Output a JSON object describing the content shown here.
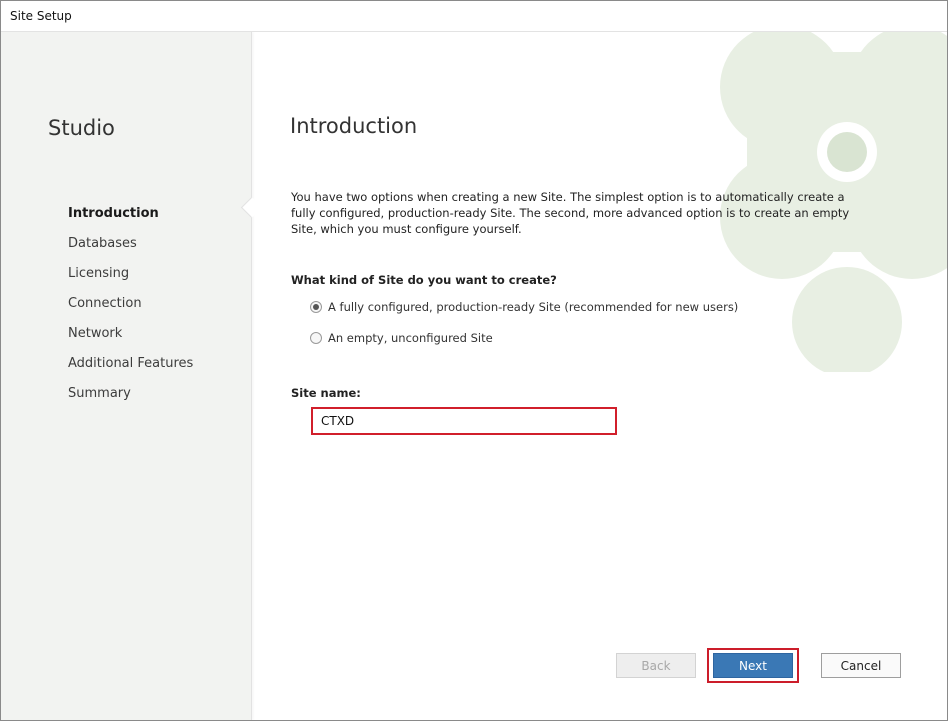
{
  "window": {
    "title": "Site Setup"
  },
  "sidebar": {
    "app_name": "Studio",
    "items": [
      {
        "label": "Introduction",
        "active": true
      },
      {
        "label": "Databases",
        "active": false
      },
      {
        "label": "Licensing",
        "active": false
      },
      {
        "label": "Connection",
        "active": false
      },
      {
        "label": "Network",
        "active": false
      },
      {
        "label": "Additional Features",
        "active": false
      },
      {
        "label": "Summary",
        "active": false
      }
    ]
  },
  "main": {
    "heading": "Introduction",
    "description": "You have two options when creating a new Site. The simplest option is to automatically create a fully configured, production-ready Site. The second, more advanced option is to create an empty Site, which you must configure yourself.",
    "question": "What kind of Site do you want to create?",
    "options": [
      {
        "label": "A fully configured, production-ready Site (recommended for new users)",
        "checked": true
      },
      {
        "label": "An empty, unconfigured Site",
        "checked": false
      }
    ],
    "site_name_label": "Site name:",
    "site_name_value": "CTXD"
  },
  "footer": {
    "back_label": "Back",
    "next_label": "Next",
    "cancel_label": "Cancel"
  },
  "colors": {
    "accent": "#3a78b5",
    "highlight": "#d11f2b",
    "sidebar_bg": "#f2f3f1",
    "decoration": "#e6ede0"
  },
  "icons": {
    "background_decoration": "citrix-logo-watermark"
  }
}
